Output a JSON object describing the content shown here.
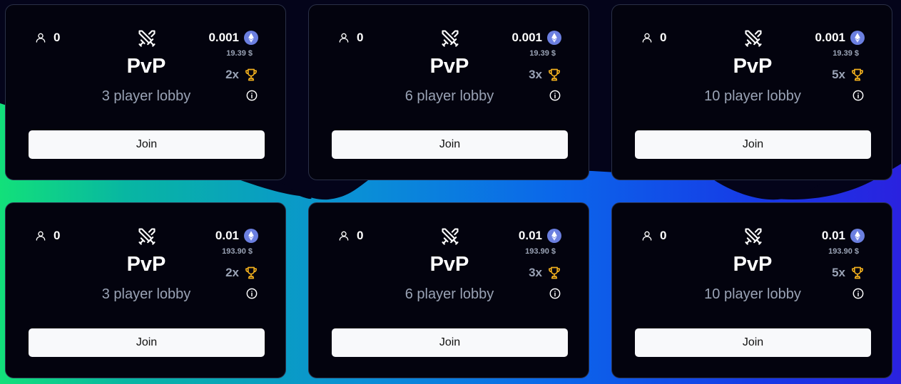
{
  "cards": [
    {
      "players": "0",
      "mode": "PvP",
      "lobby": "3 player lobby",
      "price": "0.001",
      "usd": "19.39 $",
      "multiplier": "2x",
      "join_label": "Join"
    },
    {
      "players": "0",
      "mode": "PvP",
      "lobby": "6 player lobby",
      "price": "0.001",
      "usd": "19.39 $",
      "multiplier": "3x",
      "join_label": "Join"
    },
    {
      "players": "0",
      "mode": "PvP",
      "lobby": "10 player lobby",
      "price": "0.001",
      "usd": "19.39 $",
      "multiplier": "5x",
      "join_label": "Join"
    },
    {
      "players": "0",
      "mode": "PvP",
      "lobby": "3 player lobby",
      "price": "0.01",
      "usd": "193.90 $",
      "multiplier": "2x",
      "join_label": "Join"
    },
    {
      "players": "0",
      "mode": "PvP",
      "lobby": "6 player lobby",
      "price": "0.01",
      "usd": "193.90 $",
      "multiplier": "3x",
      "join_label": "Join"
    },
    {
      "players": "0",
      "mode": "PvP",
      "lobby": "10 player lobby",
      "price": "0.01",
      "usd": "193.90 $",
      "multiplier": "5x",
      "join_label": "Join"
    }
  ],
  "icons": {
    "players": "user-icon",
    "mode": "crossed-swords-icon",
    "currency": "ethereum-icon",
    "reward": "trophy-icon",
    "info": "info-icon"
  },
  "colors": {
    "card_background": "#03030e",
    "card_border": "#2a3047",
    "muted_text": "#9aa3b5",
    "trophy": "#f2b01e",
    "eth": "#6b7fe0",
    "button": "#f8f9fb"
  }
}
